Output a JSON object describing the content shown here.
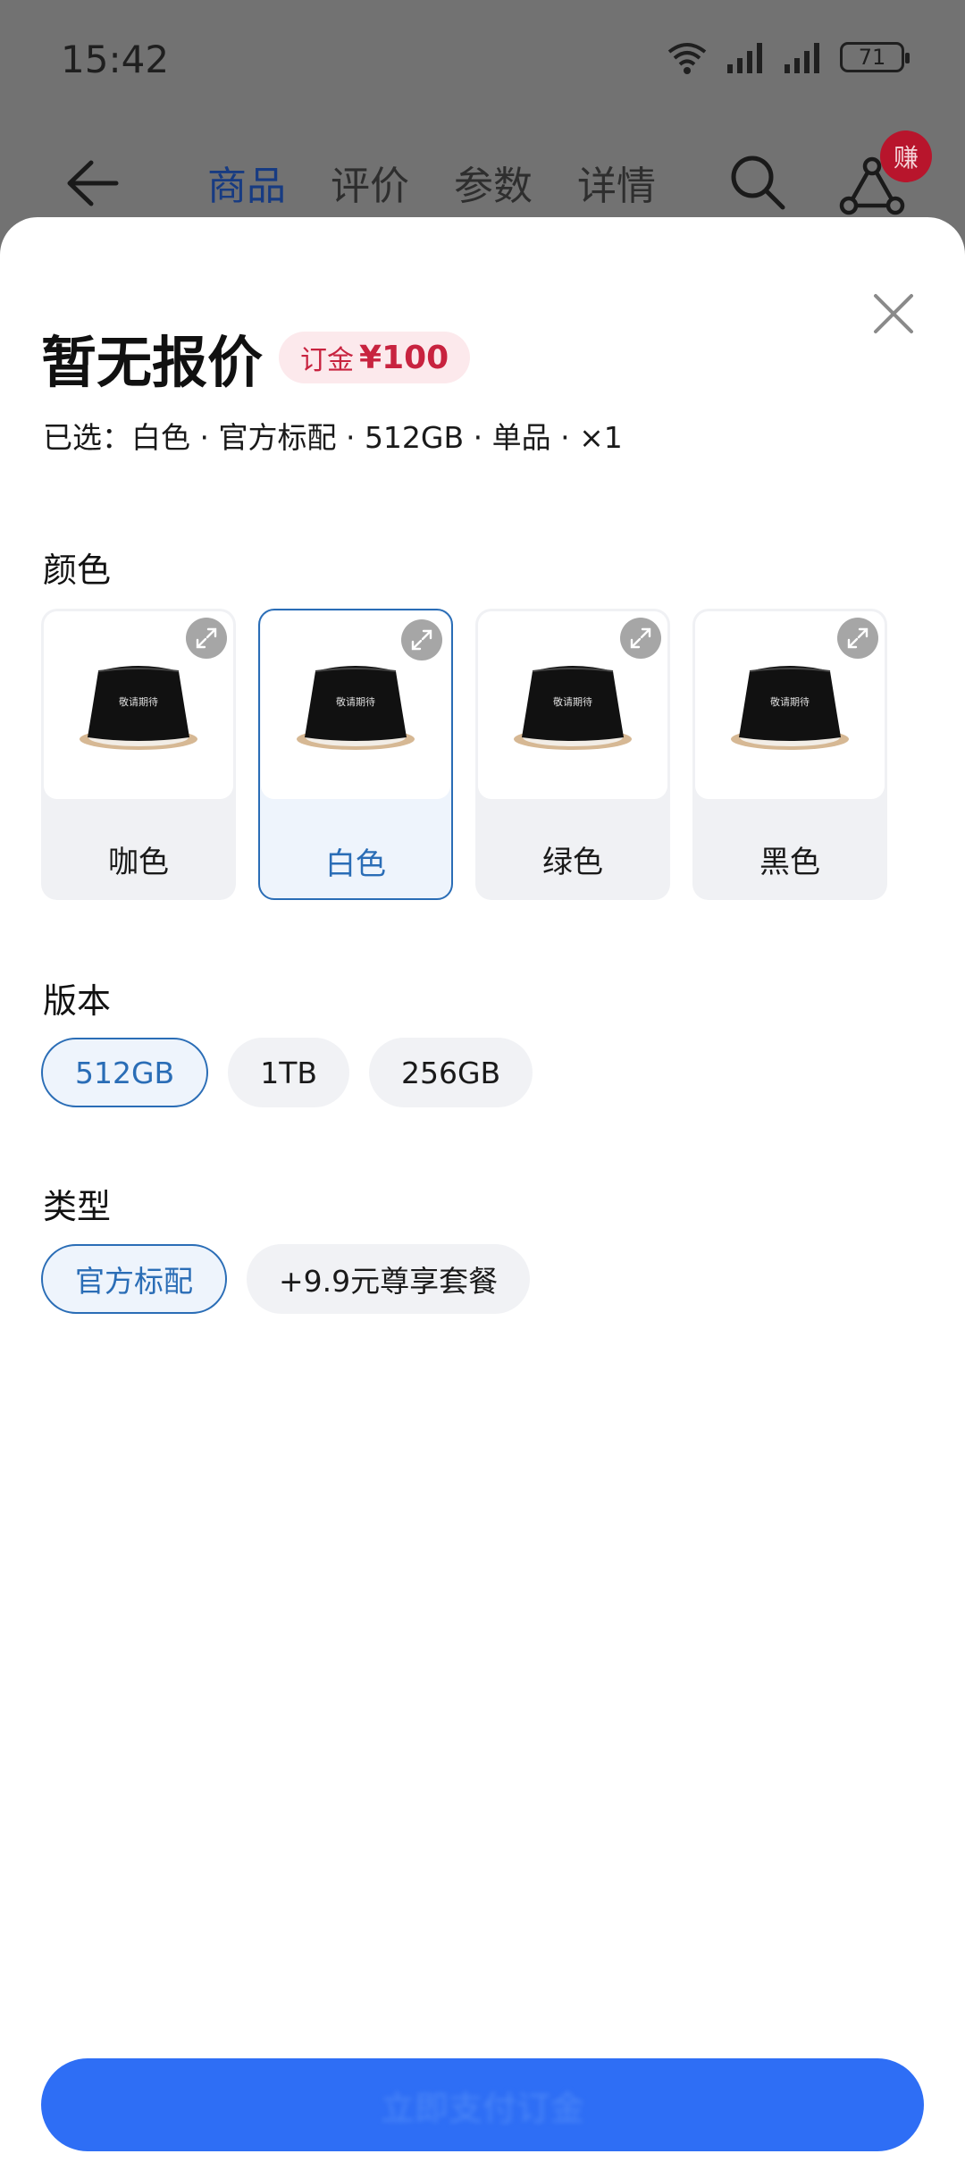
{
  "status": {
    "time": "15:42",
    "battery": "71"
  },
  "nav": {
    "tabs": [
      {
        "label": "商品",
        "active": true
      },
      {
        "label": "评价",
        "active": false
      },
      {
        "label": "参数",
        "active": false
      },
      {
        "label": "详情",
        "active": false
      }
    ],
    "earn_badge": "赚"
  },
  "sheet": {
    "price_title": "暂无报价",
    "deposit_label": "订金",
    "deposit_value": "¥100",
    "selected_summary": "已选：白色 · 官方标配 · 512GB · 单品 · ×1",
    "color_title": "颜色",
    "colors": [
      {
        "label": "咖色",
        "selected": false
      },
      {
        "label": "白色",
        "selected": true
      },
      {
        "label": "绿色",
        "selected": false
      },
      {
        "label": "黑色",
        "selected": false
      }
    ],
    "product_cover_text": "敬请期待",
    "version_title": "版本",
    "versions": [
      {
        "label": "512GB",
        "selected": true
      },
      {
        "label": "1TB",
        "selected": false
      },
      {
        "label": "256GB",
        "selected": false
      }
    ],
    "type_title": "类型",
    "types": [
      {
        "label": "官方标配",
        "selected": true
      },
      {
        "label": "+9.9元尊享套餐",
        "selected": false
      }
    ],
    "confirm_label": "立即支付订金"
  },
  "colors": {
    "accent": "#2a6db6",
    "button": "#2e6ef5",
    "deposit": "#c8233f"
  }
}
